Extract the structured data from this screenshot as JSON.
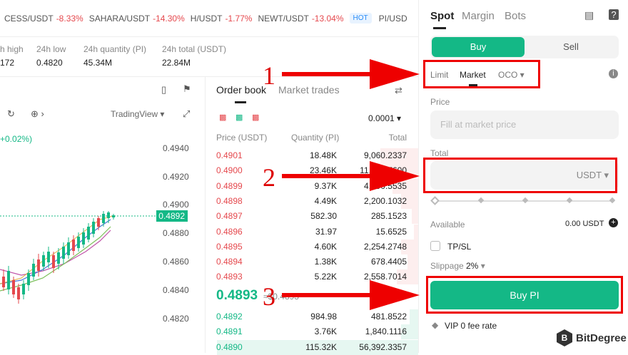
{
  "ticker": [
    {
      "pair": "CESS/USDT",
      "change": "-8.33%"
    },
    {
      "pair": "SAHARA/USDT",
      "change": "-14.30%"
    },
    {
      "pair": "H/USDT",
      "change": "-1.77%"
    },
    {
      "pair": "NEWT/USDT",
      "change": "-13.04%"
    },
    {
      "pair": "PI/USD",
      "change": ""
    }
  ],
  "ticker_badge": "HOT",
  "stats": {
    "high_label": "h high",
    "high_value": "172",
    "low_label": "24h low",
    "low_value": "0.4820",
    "qty_label": "24h quantity (PI)",
    "qty_value": "45.34M",
    "total_label": "24h total (USDT)",
    "total_value": "22.84M"
  },
  "chart": {
    "tradingview": "TradingView",
    "change_text": "+0.02%)",
    "current_price": "0.4892",
    "yticks": [
      "0.4940",
      "0.4920",
      "0.4900",
      "0.4880",
      "0.4860",
      "0.4840",
      "0.4820"
    ]
  },
  "orderbook": {
    "tab_active": "Order book",
    "tab_other": "Market trades",
    "precision": "0.0001",
    "col_price": "Price (USDT)",
    "col_qty": "Quantity (PI)",
    "col_total": "Total",
    "asks": [
      {
        "price": "0.4901",
        "qty": "18.48K",
        "total": "9,060.2337",
        "depth": 0.18
      },
      {
        "price": "0.4900",
        "qty": "23.46K",
        "total": "11,495.7600",
        "depth": 0.22
      },
      {
        "price": "0.4899",
        "qty": "9.37K",
        "total": "4,590.5535",
        "depth": 0.12
      },
      {
        "price": "0.4898",
        "qty": "4.49K",
        "total": "2,200.1032",
        "depth": 0.08
      },
      {
        "price": "0.4897",
        "qty": "582.30",
        "total": "285.1523",
        "depth": 0.03
      },
      {
        "price": "0.4896",
        "qty": "31.97",
        "total": "15.6525",
        "depth": 0.02
      },
      {
        "price": "0.4895",
        "qty": "4.60K",
        "total": "2,254.2748",
        "depth": 0.08
      },
      {
        "price": "0.4894",
        "qty": "1.38K",
        "total": "678.4405",
        "depth": 0.05
      },
      {
        "price": "0.4893",
        "qty": "5.22K",
        "total": "2,558.7014",
        "depth": 0.1
      }
    ],
    "mid_price": "0.4893",
    "mid_sub": "≈$0.4893",
    "bids": [
      {
        "price": "0.4892",
        "qty": "984.98",
        "total": "481.8522",
        "depth": 0.04
      },
      {
        "price": "0.4891",
        "qty": "3.76K",
        "total": "1,840.1116",
        "depth": 0.08
      },
      {
        "price": "0.4890",
        "qty": "115.32K",
        "total": "56,392.3357",
        "depth": 0.95
      }
    ]
  },
  "panel": {
    "tabs": [
      "Spot",
      "Margin",
      "Bots"
    ],
    "buy": "Buy",
    "sell": "Sell",
    "order_types": [
      "Limit",
      "Market",
      "OCO"
    ],
    "price_label": "Price",
    "price_placeholder": "Fill at market price",
    "total_label": "Total",
    "total_unit": "USDT",
    "available_label": "Available",
    "available_value": "0.00 USDT",
    "tpsl": "TP/SL",
    "slippage_label": "Slippage",
    "slippage_value": "2%",
    "buy_button": "Buy PI",
    "vip": "VIP 0 fee rate"
  },
  "annotations": [
    "1",
    "2",
    "3"
  ],
  "watermark": "BitDegree",
  "colors": {
    "green": "#14b886",
    "red": "#e5484d",
    "annotation": "#e00000"
  }
}
